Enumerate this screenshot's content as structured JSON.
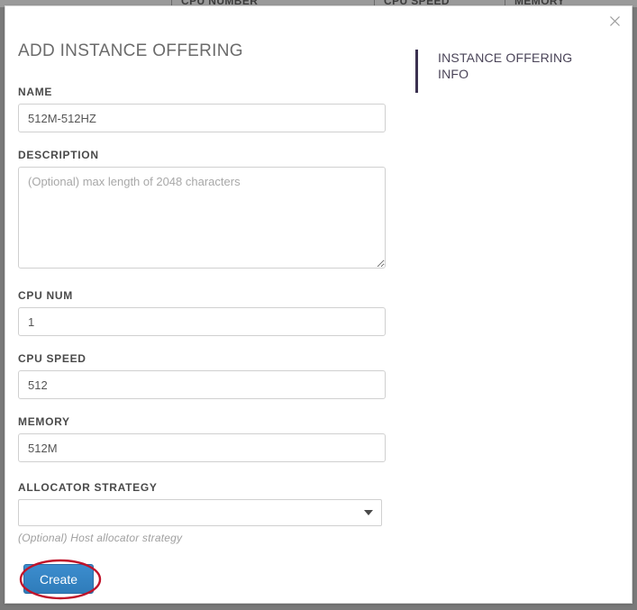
{
  "background": {
    "table_headers": [
      "CPU NUMBER",
      "CPU SPEED",
      "MEMORY"
    ]
  },
  "modal": {
    "title": "ADD INSTANCE OFFERING",
    "close_icon": "close-icon",
    "info_panel": {
      "title": "INSTANCE OFFERING INFO",
      "accent_color": "#3b3150"
    },
    "fields": {
      "name": {
        "label": "NAME",
        "value": "512M-512HZ",
        "placeholder": ""
      },
      "description": {
        "label": "DESCRIPTION",
        "value": "",
        "placeholder": "(Optional) max length of 2048 characters"
      },
      "cpu_num": {
        "label": "CPU NUM",
        "value": "1",
        "placeholder": ""
      },
      "cpu_speed": {
        "label": "CPU SPEED",
        "value": "512",
        "placeholder": ""
      },
      "memory": {
        "label": "MEMORY",
        "value": "512M",
        "placeholder": ""
      },
      "allocator_strategy": {
        "label": "ALLOCATOR STRATEGY",
        "value": "",
        "hint": "(Optional) Host allocator strategy",
        "dropdown_icon": "chevron-down-icon"
      }
    },
    "create_button": {
      "label": "Create",
      "color": "#2f7cba",
      "text_color": "#ffffff"
    },
    "annotation": {
      "shape": "ellipse",
      "color": "#c0132a"
    }
  }
}
